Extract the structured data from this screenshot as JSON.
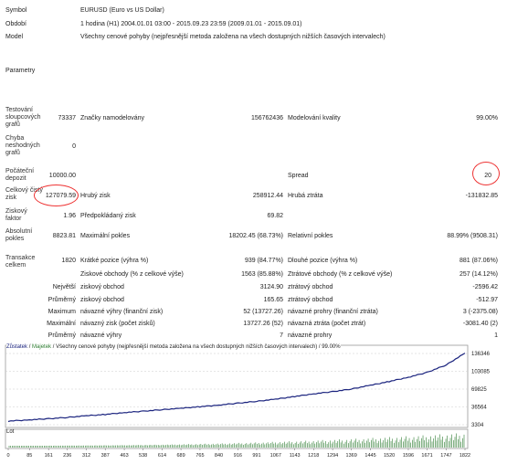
{
  "header": {
    "symbol_label": "Symbol",
    "symbol_value": "EURUSD (Euro vs US Dollar)",
    "period_label": "Období",
    "period_value": "1 hodina (H1) 2004.01.01 03:00 - 2015.09.23 23:59 (2009.01.01 - 2015.09.01)",
    "model_label": "Model",
    "model_value": "Všechny cenové pohyby (nejpřesnější metoda založena na všech dostupných nižších časových intervalech)",
    "params_label": "Parametry"
  },
  "stats": {
    "bars_label": "Testování sloupcových grafů",
    "bars_value": "73337",
    "ticks_label": "Značky namodelovány",
    "ticks_value": "156762436",
    "quality_label": "Modelování kvality",
    "quality_value": "99.00%",
    "errors_label": "Chyba neshodných grafů",
    "errors_value": "0",
    "deposit_label": "Počáteční depozit",
    "deposit_value": "10000.00",
    "spread_label": "Spread",
    "spread_value": "20",
    "net_label": "Celkový čistý zisk",
    "net_value": "127079.59",
    "gross_profit_label": "Hrubý zisk",
    "gross_profit_value": "258912.44",
    "gross_loss_label": "Hrubá ztráta",
    "gross_loss_value": "-131832.85",
    "pf_label": "Ziskový faktor",
    "pf_value": "1.96",
    "payoff_label": "Předpokládaný zisk",
    "payoff_value": "69.82",
    "abs_dd_label": "Absolutní pokles",
    "abs_dd_value": "8823.81",
    "max_dd_label": "Maximální pokles",
    "max_dd_value": "18202.45 (68.73%)",
    "rel_dd_label": "Relativní pokles",
    "rel_dd_value": "88.99% (9508.31)",
    "trades_label": "Transakce celkem",
    "trades_value": "1820",
    "short_label": "Krátké pozice (výhra %)",
    "short_value": "939 (84.77%)",
    "long_label": "Dlouhé pozice (výhra %)",
    "long_value": "881 (87.06%)",
    "win_label": "Ziskové obchody (% z celkové výše)",
    "win_value": "1563 (85.88%)",
    "loss_label": "Ztrátové obchody (% z celkové výše)",
    "loss_value": "257 (14.12%)",
    "largest_label": "Největší",
    "largest_win_label": "ziskový obchod",
    "largest_win_value": "3124.90",
    "largest_loss_label": "ztrátový obchod",
    "largest_loss_value": "-2596.42",
    "avg_label": "Průměrný",
    "avg_win_label": "ziskový obchod",
    "avg_win_value": "165.65",
    "avg_loss_label": "ztrátový obchod",
    "avg_loss_value": "-512.97",
    "max1_label": "Maximum",
    "max_cons_wins_label": "návazné výhry (finanční zisk)",
    "max_cons_wins_value": "52 (13727.26)",
    "max_cons_losses_label": "návazné prohry (finanční ztráta)",
    "max_cons_losses_value": "3 (-2375.08)",
    "max2_label": "Maximální",
    "max_cons_profit_label": "návazný zisk (počet zisků)",
    "max_cons_profit_value": "13727.26 (52)",
    "max_cons_loss_label": "návazná ztráta (počet ztrát)",
    "max_cons_loss_value": "-3081.40 (2)",
    "avg2_label": "Průměrný",
    "avg_cons_wins_label": "návazné výhry",
    "avg_cons_wins_value": "7",
    "avg_cons_losses_label": "návazné prohry",
    "avg_cons_losses_value": "1"
  },
  "chart_legend": {
    "balance": "Zůstatek",
    "sep1": "/",
    "equity": "Majetek",
    "sep2": "/",
    "rest": "Všechny cenové pohyby (nejpřesnější metoda založena na všech dostupných nižších časových intervalech) / 99.00%"
  },
  "lots_label": "Lot",
  "colors": {
    "balance_line": "#1a237e",
    "grid": "#cccccc",
    "lot_bars": "#2e7d32",
    "highlight": "#e33333"
  },
  "chart_data": {
    "type": "line",
    "yticks": [
      "136346",
      "103085",
      "69825",
      "36564",
      "3304"
    ],
    "xticks": [
      "0",
      "85",
      "161",
      "236",
      "312",
      "387",
      "463",
      "538",
      "614",
      "689",
      "765",
      "840",
      "916",
      "991",
      "1067",
      "1143",
      "1218",
      "1294",
      "1369",
      "1445",
      "1520",
      "1596",
      "1671",
      "1747",
      "1822"
    ],
    "ylim": [
      3304,
      136346
    ],
    "x": [
      0,
      85,
      161,
      236,
      312,
      387,
      463,
      538,
      614,
      689,
      765,
      840,
      916,
      991,
      1067,
      1143,
      1218,
      1294,
      1369,
      1445,
      1520,
      1596,
      1671,
      1747,
      1822
    ],
    "values": [
      10000,
      12500,
      14500,
      17000,
      20000,
      22500,
      26000,
      28500,
      31500,
      34000,
      37000,
      40000,
      43500,
      47000,
      51000,
      56000,
      61000,
      65000,
      70000,
      77000,
      84000,
      92000,
      101000,
      115000,
      137000
    ]
  }
}
